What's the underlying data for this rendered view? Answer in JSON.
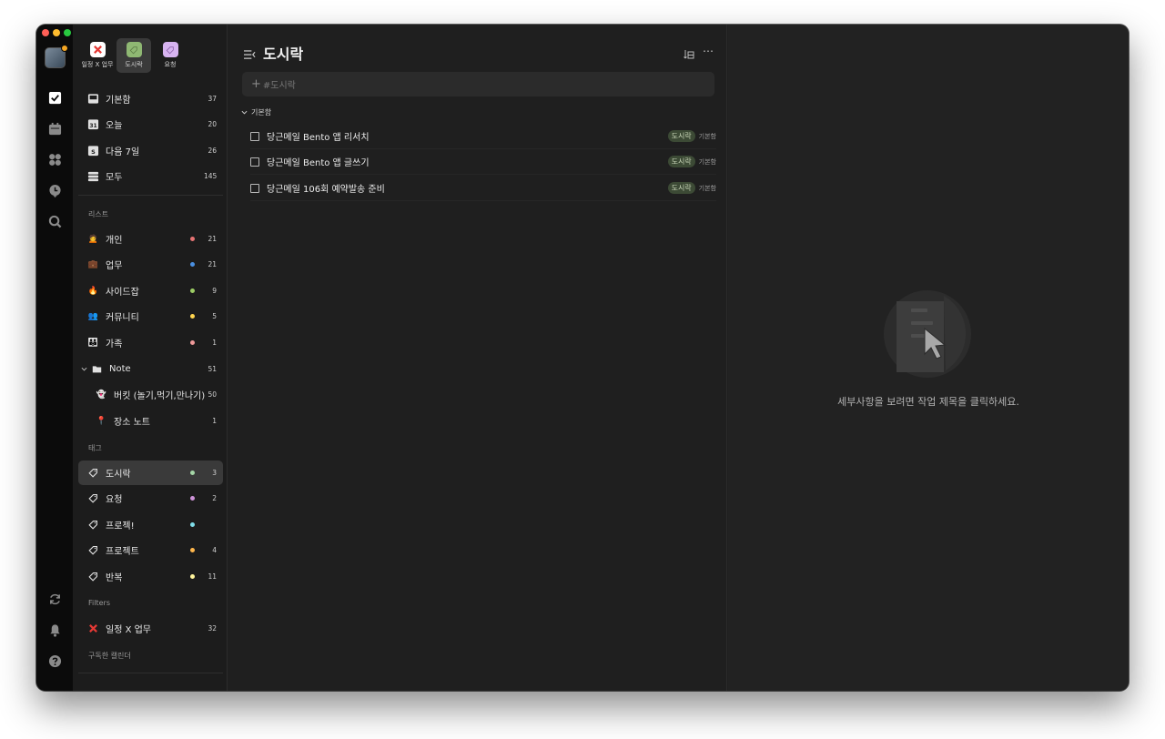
{
  "window": {
    "pinned": [
      {
        "label": "일정 X 업무",
        "icon": "x-mark-icon",
        "color": "#e53935"
      },
      {
        "label": "도시락",
        "icon": "tag-icon",
        "color": "#a9c98a"
      },
      {
        "label": "요청",
        "icon": "tag-icon",
        "color": "#d7b3f0"
      }
    ]
  },
  "sidebar": {
    "smart": [
      {
        "label": "기본함",
        "count": "37",
        "icon": "inbox-icon"
      },
      {
        "label": "오늘",
        "count": "20",
        "icon": "calendar-today-icon",
        "glyph": "31"
      },
      {
        "label": "다음 7일",
        "count": "26",
        "icon": "calendar-week-icon",
        "glyph": "S"
      },
      {
        "label": "모두",
        "count": "145",
        "icon": "all-icon"
      }
    ],
    "lists_section": "리스트",
    "lists": [
      {
        "label": "개인",
        "count": "21",
        "emoji": "🙍",
        "dot": "#e57373"
      },
      {
        "label": "업무",
        "count": "21",
        "emoji": "💼",
        "dot": "#4a90e2"
      },
      {
        "label": "사이드잡",
        "count": "9",
        "emoji": "🔥",
        "dot": "#9ccc65"
      },
      {
        "label": "커뮤니티",
        "count": "5",
        "emoji": "👥",
        "dot": "#ffd54f"
      },
      {
        "label": "가족",
        "count": "1",
        "emoji": "👪",
        "dot": "#ef9a9a"
      }
    ],
    "folder": {
      "label": "Note",
      "count": "51"
    },
    "folder_items": [
      {
        "label": "버킷 (놀기,먹기,만나기)",
        "count": "50",
        "emoji": "👻"
      },
      {
        "label": "장소 노트",
        "count": "1",
        "emoji": "📍"
      }
    ],
    "tags_section": "태그",
    "tags": [
      {
        "label": "도시락",
        "count": "3",
        "dot": "#a5d6a7"
      },
      {
        "label": "요청",
        "count": "2",
        "dot": "#ce93d8"
      },
      {
        "label": "프로젝!",
        "count": "",
        "dot": "#80deea"
      },
      {
        "label": "프로젝트",
        "count": "4",
        "dot": "#ffb74d"
      },
      {
        "label": "반복",
        "count": "11",
        "dot": "#fff59d"
      }
    ],
    "filters_section": "Filters",
    "filters": [
      {
        "label": "일정 X 업무",
        "count": "32"
      }
    ],
    "calendar_section": "구독한 캘린더"
  },
  "list": {
    "title": "도시락",
    "add_placeholder": "#도시락",
    "group": "기본함",
    "tasks": [
      {
        "title": "당근메일 Bento 앱 리서치",
        "tag": "도시락",
        "list": "기본함"
      },
      {
        "title": "당근메일 Bento 앱 글쓰기",
        "tag": "도시락",
        "list": "기본함"
      },
      {
        "title": "당근메일 106회 예약발송 준비",
        "tag": "도시락",
        "list": "기본함"
      }
    ]
  },
  "detail": {
    "empty_message": "세부사항을 보려면 작업 제목을 클릭하세요."
  }
}
